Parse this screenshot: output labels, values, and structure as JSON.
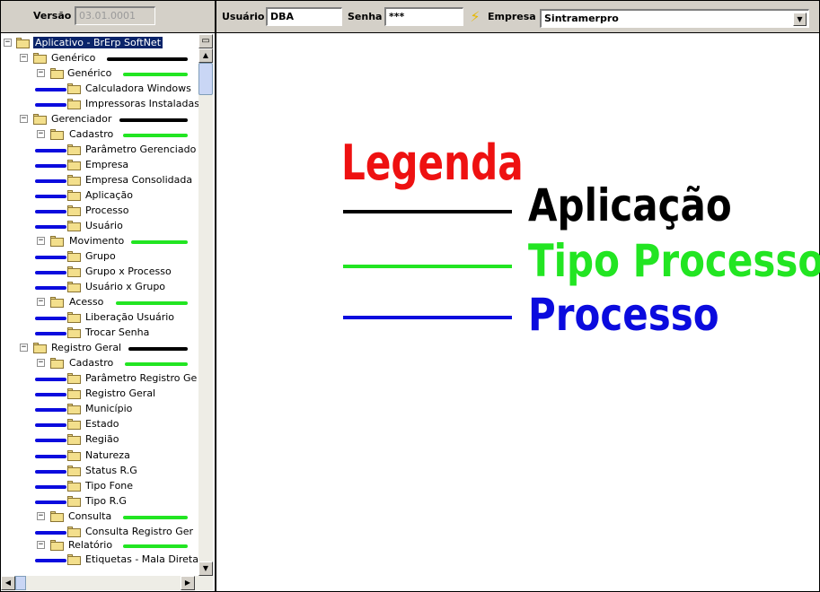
{
  "toolbar": {
    "version_label": "Versão",
    "version_value": "03.01.0001",
    "user_label": "Usuário",
    "user_value": "DBA",
    "password_label": "Senha",
    "password_value": "***",
    "company_label": "Empresa",
    "company_value": "Sintramerpro"
  },
  "tree": {
    "root": "Aplicativo - BrErp SoftNet",
    "generico": "Genérico",
    "generico_tipo": "Genérico",
    "calculadora": "Calculadora Windows",
    "impressoras": "Impressoras Instaladas",
    "gerenciador": "Gerenciador",
    "cadastro1": "Cadastro",
    "parametro_gerenciado": "Parâmetro Gerenciado",
    "empresa": "Empresa",
    "empresa_consolidada": "Empresa Consolidada",
    "aplicacao": "Aplicação",
    "processo": "Processo",
    "usuario": "Usuário",
    "movimento": "Movimento",
    "grupo": "Grupo",
    "grupo_processo": "Grupo x Processo",
    "usuario_grupo": "Usuário x Grupo",
    "acesso": "Acesso",
    "liberacao": "Liberação Usuário",
    "trocar_senha": "Trocar Senha",
    "registro_geral": "Registro Geral",
    "cadastro2": "Cadastro",
    "parametro_registro": "Parâmetro Registro Ge",
    "registro_geral_item": "Registro Geral",
    "municipio": "Município",
    "estado": "Estado",
    "regiao": "Região",
    "natureza": "Natureza",
    "status_rg": "Status R.G",
    "tipo_fone": "Tipo Fone",
    "tipo_rg": "Tipo R.G",
    "consulta": "Consulta",
    "consulta_registro": "Consulta Registro Ger",
    "relatorio": "Relatório",
    "etiquetas": "Etiquetas - Mala Direta"
  },
  "legend": {
    "title": "Legenda",
    "aplicacao": "Aplicação",
    "tipo_processo": "Tipo Processo",
    "processo": "Processo",
    "colors": {
      "title": "#ee1111",
      "aplicacao": "#000000",
      "tipo_processo": "#22e522",
      "processo": "#0b0bde"
    }
  },
  "icons": {
    "expand": "minus-box-icon",
    "folder": "folder-icon",
    "connect": "lightning-bolt-icon",
    "dropdown": "chevron-down-icon"
  }
}
